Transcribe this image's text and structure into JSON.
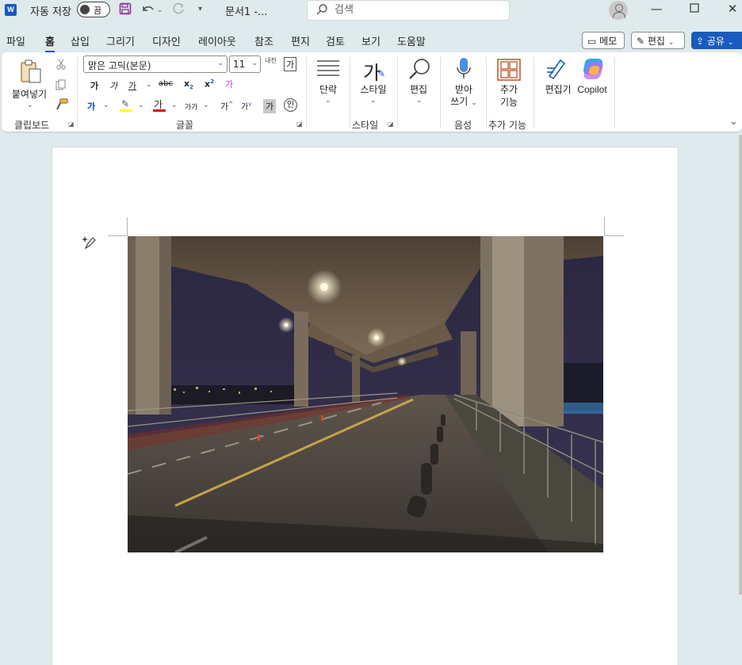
{
  "titlebar": {
    "app_icon": "W",
    "autosave_label": "자동 저장",
    "autosave_state": "끔",
    "doc_title": "문서1  -...",
    "search_placeholder": "검색"
  },
  "menu": {
    "tabs": [
      "파일",
      "홈",
      "삽입",
      "그리기",
      "디자인",
      "레이아웃",
      "참조",
      "편지",
      "검토",
      "보기",
      "도움말"
    ],
    "memo_label": "메모",
    "edit_label": "편집",
    "share_label": "공유"
  },
  "ribbon": {
    "paste_label": "붙여넣기",
    "clipboard_group": "클립보드",
    "font_name": "맑은 고딕(본문)",
    "font_size": "11",
    "font_group": "글꼴",
    "paragraph_label": "단락",
    "style_label": "스타일",
    "style_group": "스타일",
    "editing_label": "편집",
    "dictate_label_1": "받아",
    "dictate_label_2": "쓰기",
    "voice_group": "음성",
    "addins_label_1": "추가",
    "addins_label_2": "기능",
    "addins_group": "추가 기능",
    "editor_label": "편집기",
    "copilot_label": "Copilot",
    "bold": "가",
    "italic": "가",
    "underline": "가",
    "strike": "abc",
    "sub": "x",
    "sup": "x",
    "hanja": "가",
    "effects": "가",
    "highlight": "가",
    "font_color": "가",
    "char_size": "가가",
    "grow": "가",
    "shrink": "가",
    "char_shade": "가",
    "enclose": "인",
    "phonetic": "내천",
    "char_border": "가",
    "style_icon": "가"
  },
  "colors": {
    "accent": "#185abd",
    "highlight_bar": "#ffff00",
    "font_color_bar": "#e00000",
    "background": "#dfeaec"
  }
}
